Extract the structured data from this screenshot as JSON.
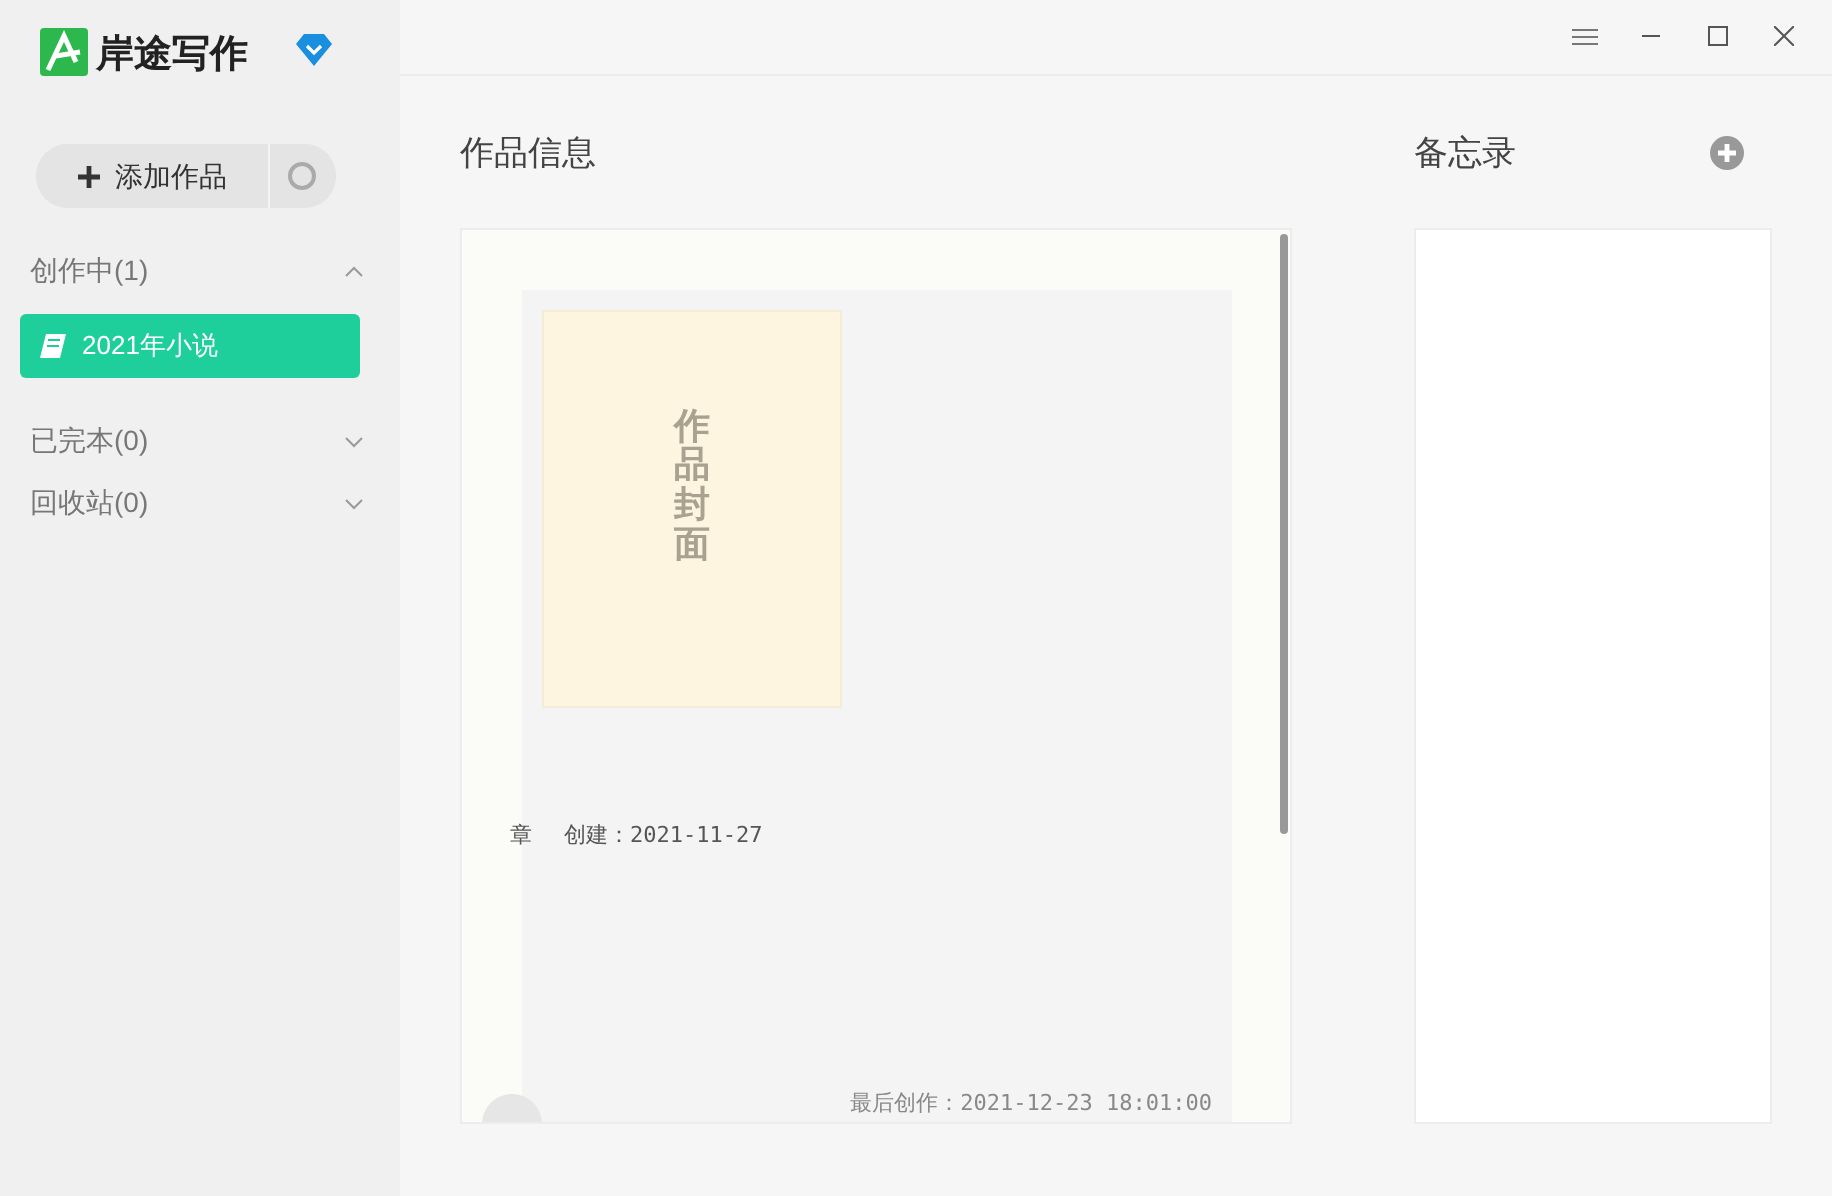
{
  "app": {
    "name": "岸途写作"
  },
  "add_button": {
    "label": "添加作品"
  },
  "sections": [
    {
      "label": "创作中(1)",
      "expanded": true,
      "items": [
        {
          "label": "2021年小说",
          "selected": true
        }
      ]
    },
    {
      "label": "已完本(0)",
      "expanded": false
    },
    {
      "label": "回收站(0)",
      "expanded": false
    }
  ],
  "work_info": {
    "title": "作品信息",
    "cover_text": "作品封面",
    "cut_text": "章",
    "created": "创建：2021-11-27",
    "last_written": "最后创作：2021-12-23 18:01:00"
  },
  "memo": {
    "title": "备忘录"
  }
}
